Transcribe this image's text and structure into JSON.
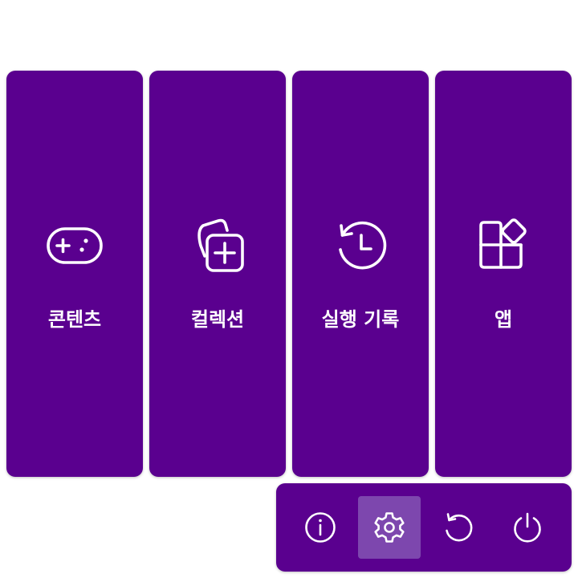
{
  "tiles": [
    {
      "label": "콘텐츠",
      "icon": "gamepad-icon"
    },
    {
      "label": "컬렉션",
      "icon": "collection-add-icon"
    },
    {
      "label": "실행 기록",
      "icon": "history-icon"
    },
    {
      "label": "앱",
      "icon": "apps-icon"
    }
  ],
  "power_bar": {
    "buttons": [
      {
        "icon": "info-icon",
        "active": false
      },
      {
        "icon": "gear-icon",
        "active": true
      },
      {
        "icon": "restart-icon",
        "active": false
      },
      {
        "icon": "power-icon",
        "active": false
      }
    ]
  },
  "colors": {
    "tile_bg": "#5a008f",
    "active_button_bg": "#7d47ae",
    "foreground": "#ffffff",
    "page_bg": "#ffffff"
  }
}
